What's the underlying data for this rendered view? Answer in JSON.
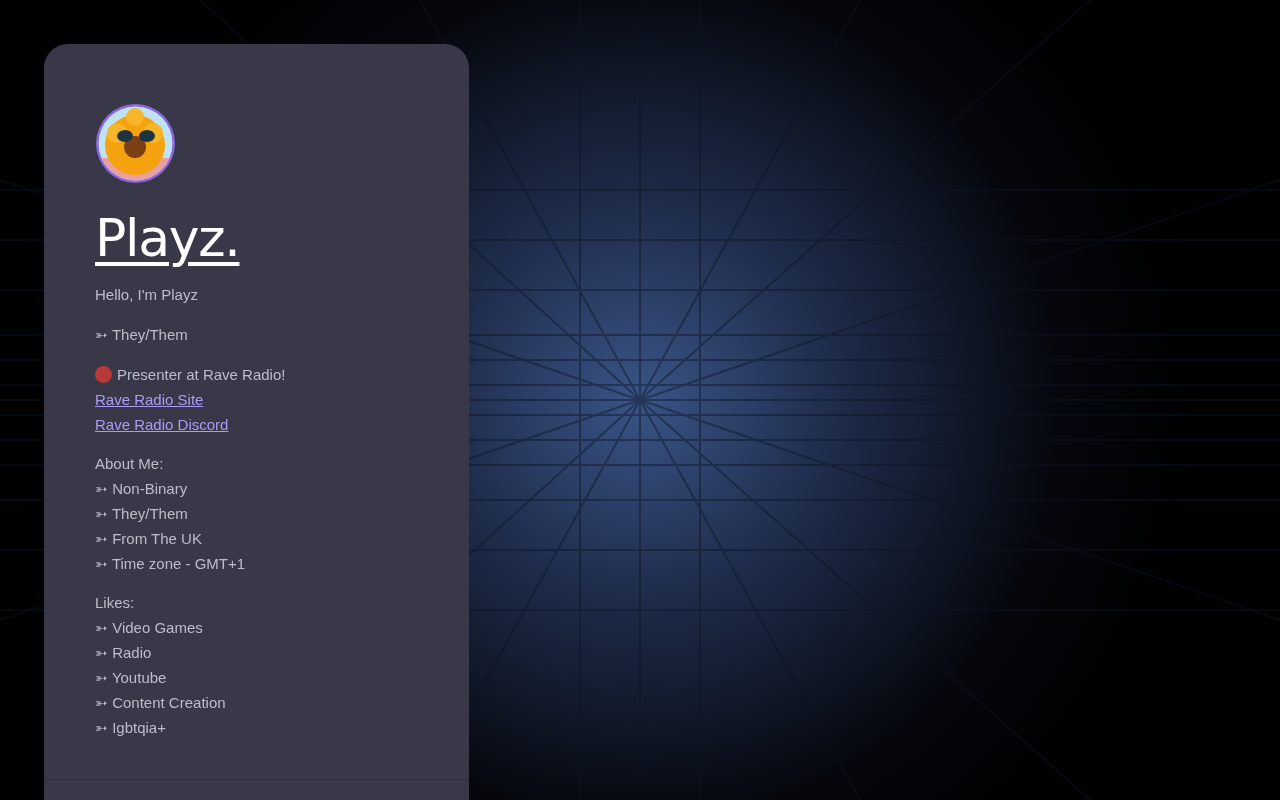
{
  "profile": {
    "title": "Playz.",
    "greeting": "Hello, I'm Playz",
    "pronouns": "➳ They/Them",
    "presenter": {
      "text": "Presenter at Rave Radio!"
    },
    "links": [
      {
        "label": "Rave Radio Site"
      },
      {
        "label": "Rave Radio Discord"
      }
    ],
    "sections": [
      {
        "heading": "About Me:",
        "items": [
          "➳ Non-Binary",
          "➳ They/Them",
          "➳ From The UK",
          "➳ Time zone - GMT+1"
        ]
      },
      {
        "heading": "Likes:",
        "items": [
          "➳ Video Games",
          "➳ Radio",
          "➳ Youtube",
          "➳ Content Creation",
          "➳ Igbtqia+"
        ]
      }
    ]
  }
}
